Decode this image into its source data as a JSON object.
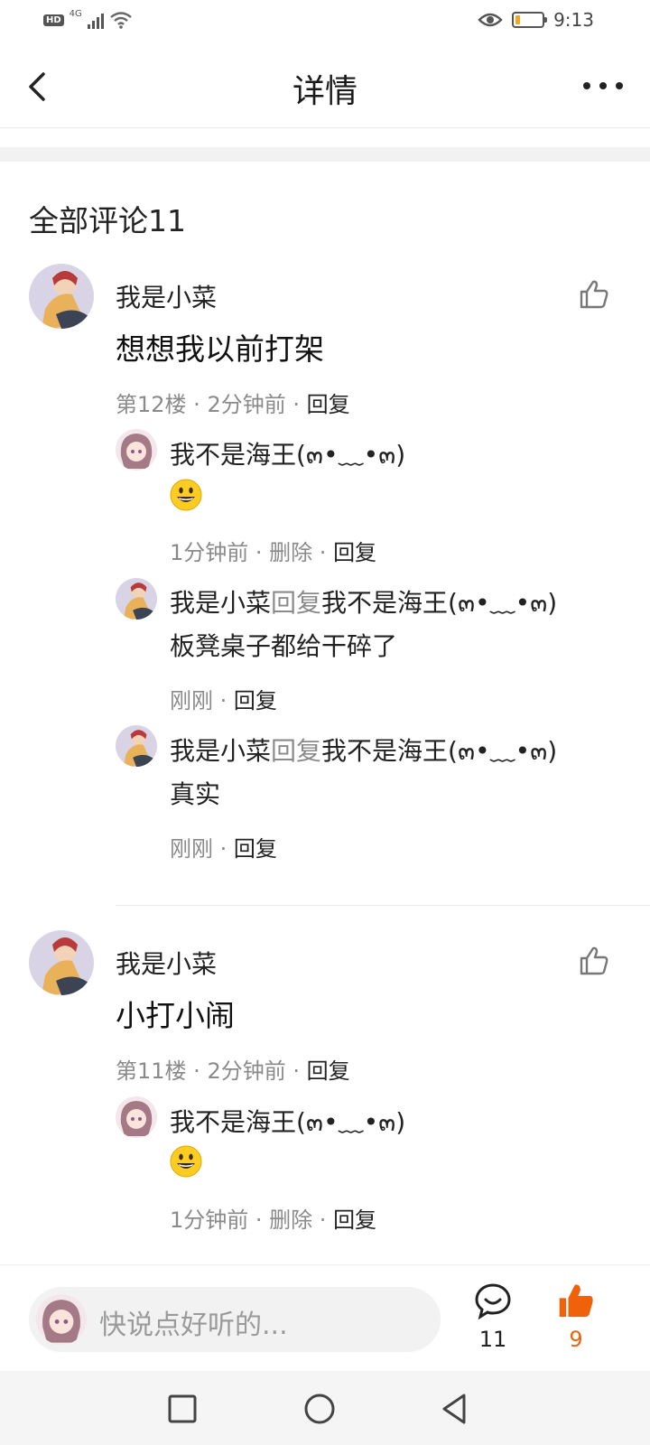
{
  "status_bar": {
    "hd": "HD",
    "network": "4G",
    "time": "9:13",
    "battery_level": 0.15,
    "icons": [
      "hd-icon",
      "signal-icon",
      "wifi-icon",
      "eye-icon",
      "battery-icon"
    ]
  },
  "nav": {
    "title": "详情",
    "back_icon": "chevron-left-icon",
    "more_icon": "more-dots-icon"
  },
  "comments_header": "全部评论11",
  "comments": [
    {
      "author": "我是小菜",
      "text": "想想我以前打架",
      "floor": "第12楼",
      "time": "2分钟前",
      "reply_label": "回复",
      "replies": [
        {
          "author": "我不是海王(๓•﹏•๓)",
          "emoji": "😃",
          "time": "1分钟前",
          "delete_label": "删除",
          "reply_label": "回复"
        },
        {
          "author": "我是小菜",
          "reply_word": "回复",
          "target": "我不是海王(๓•﹏•๓)",
          "text": "板凳桌子都给干碎了",
          "time": "刚刚",
          "reply_label": "回复"
        },
        {
          "author": "我是小菜",
          "reply_word": "回复",
          "target": "我不是海王(๓•﹏•๓)",
          "text": "真实",
          "time": "刚刚",
          "reply_label": "回复"
        }
      ]
    },
    {
      "author": "我是小菜",
      "text": "小打小闹",
      "floor": "第11楼",
      "time": "2分钟前",
      "reply_label": "回复",
      "replies": [
        {
          "author": "我不是海王(๓•﹏•๓)",
          "emoji": "😃",
          "time": "1分钟前",
          "delete_label": "删除",
          "reply_label": "回复"
        }
      ]
    }
  ],
  "separator": " · ",
  "bottom_bar": {
    "placeholder": "快说点好听的...",
    "comment_count": "11",
    "like_count": "9",
    "like_color": "#f0620a"
  },
  "colors": {
    "accent": "#f0620a",
    "meta_gray": "#8a8a8a"
  }
}
